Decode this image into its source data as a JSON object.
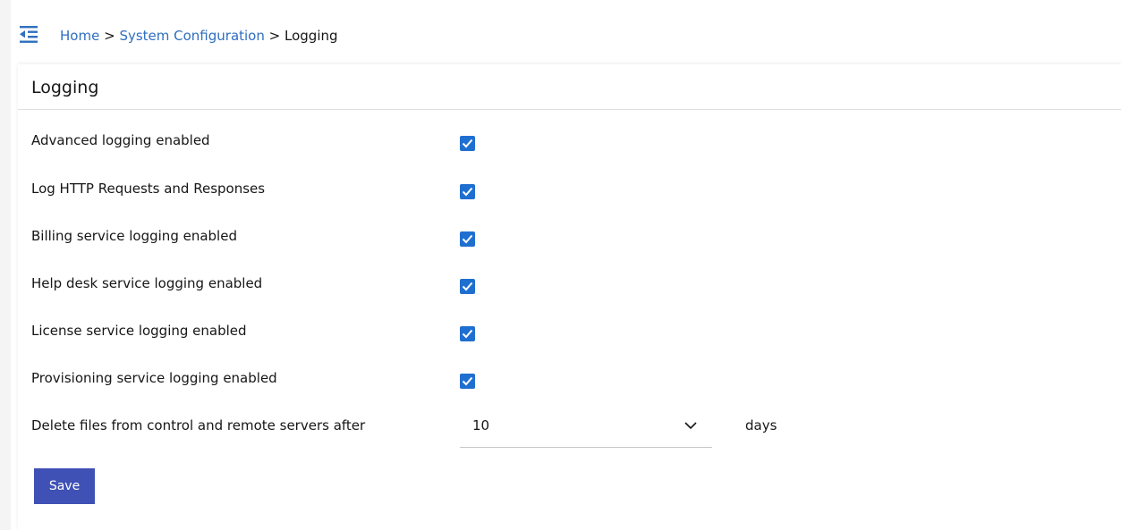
{
  "breadcrumb": {
    "home": "Home",
    "sep1": ">",
    "system_configuration": "System Configuration",
    "sep2": ">",
    "current": "Logging"
  },
  "card": {
    "title": "Logging"
  },
  "settings": [
    {
      "label": "Advanced logging enabled",
      "checked": true
    },
    {
      "label": "Log HTTP Requests and Responses",
      "checked": true
    },
    {
      "label": "Billing service logging enabled",
      "checked": true
    },
    {
      "label": "Help desk service logging enabled",
      "checked": true
    },
    {
      "label": "License service logging enabled",
      "checked": true
    },
    {
      "label": "Provisioning service logging enabled",
      "checked": true
    }
  ],
  "retention": {
    "label": "Delete files from control and remote servers after",
    "value": "10",
    "unit": "days"
  },
  "actions": {
    "save_label": "Save"
  },
  "colors": {
    "link": "#2f6fbf",
    "checkbox": "#1f6fd1",
    "button": "#3f51b5"
  },
  "icons": {
    "menu_toggle": "menu-collapse-icon",
    "checkbox_mark": "checkmark-icon",
    "select_chevron": "chevron-down-icon"
  }
}
